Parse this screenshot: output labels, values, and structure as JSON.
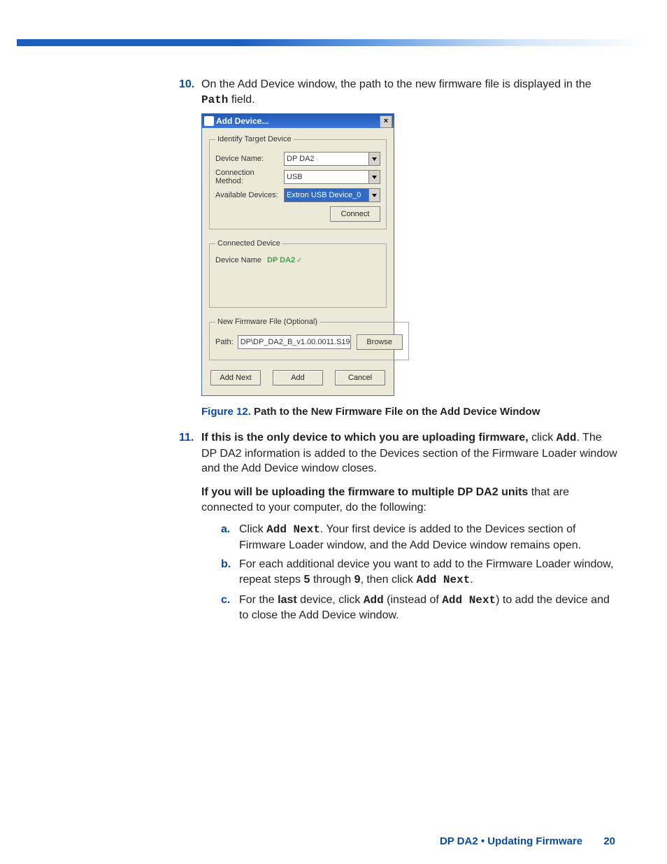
{
  "steps": {
    "s10": {
      "num": "10.",
      "text_a": "On the Add Device window, the path to the new firmware file is displayed in the ",
      "code": "Path",
      "text_b": " field."
    },
    "s11": {
      "num": "11.",
      "lead_bold": "If this is the only device to which you are uploading firmware,",
      "lead_rest": " click ",
      "lead_code": "Add",
      "lead_end": ". The DP DA2 information is added to the Devices section of the Firmware Loader window and the Add Device window closes.",
      "multi_bold": "If you will be uploading the firmware to multiple DP DA2 units",
      "multi_rest": " that are connected to your computer, do the following:",
      "a": {
        "mk": "a.",
        "t1": "Click ",
        "c1": "Add Next",
        "t2": ". Your first device is added to the Devices section of Firmware Loader window, and the Add Device window remains open."
      },
      "b": {
        "mk": "b.",
        "t1": "For each additional device you want to add to the Firmware Loader window, repeat steps ",
        "b1": "5",
        "t2": " through ",
        "b2": "9",
        "t3": ", then click ",
        "c1": "Add Next",
        "t4": "."
      },
      "c": {
        "mk": "c.",
        "t1": "For the ",
        "b1": "last",
        "t2": " device, click ",
        "c1": "Add",
        "t3": " (instead of ",
        "c2": "Add Next",
        "t4": ") to add the device and to close the Add Device window."
      }
    }
  },
  "figure": {
    "label": "Figure 12.",
    "caption": "Path to the New Firmware File on the Add Device Window"
  },
  "window": {
    "title": "Add Device...",
    "close": "×",
    "group_identify": "Identify Target Device",
    "device_name_lbl": "Device Name:",
    "device_name_val": "DP DA2",
    "conn_method_lbl": "Connection Method:",
    "conn_method_val": "USB",
    "avail_lbl": "Available Devices:",
    "avail_val": "Extron USB Device_0",
    "connect_btn": "Connect",
    "group_connected": "Connected Device",
    "connected_lbl": "Device Name",
    "connected_val": "DP DA2",
    "check": "✓",
    "group_fw": "New Firmware File (Optional)",
    "path_lbl": "Path:",
    "path_val": "DP\\DP_DA2_B_v1.00.0011.S19",
    "browse_btn": "Browse",
    "add_next_btn": "Add Next",
    "add_btn": "Add",
    "cancel_btn": "Cancel"
  },
  "footer": {
    "section": "DP DA2 • Updating Firmware",
    "page": "20"
  }
}
